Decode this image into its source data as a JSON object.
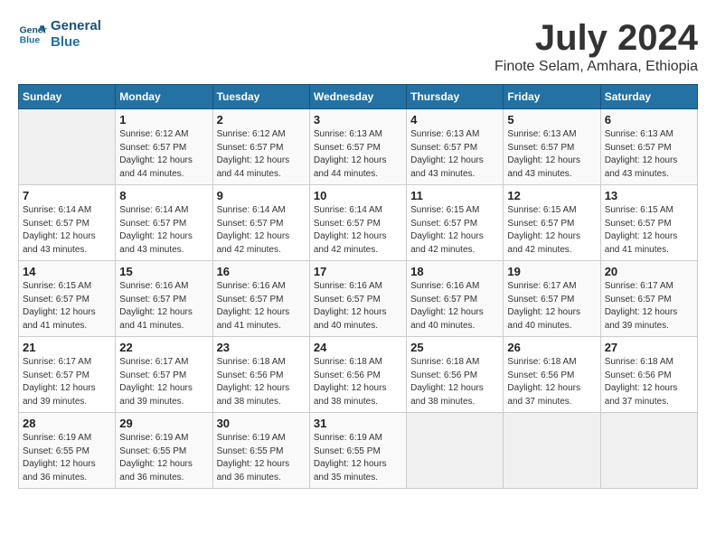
{
  "logo": {
    "line1": "General",
    "line2": "Blue"
  },
  "title": "July 2024",
  "subtitle": "Finote Selam, Amhara, Ethiopia",
  "days_of_week": [
    "Sunday",
    "Monday",
    "Tuesday",
    "Wednesday",
    "Thursday",
    "Friday",
    "Saturday"
  ],
  "weeks": [
    [
      {
        "day": "",
        "info": ""
      },
      {
        "day": "1",
        "info": "Sunrise: 6:12 AM\nSunset: 6:57 PM\nDaylight: 12 hours\nand 44 minutes."
      },
      {
        "day": "2",
        "info": "Sunrise: 6:12 AM\nSunset: 6:57 PM\nDaylight: 12 hours\nand 44 minutes."
      },
      {
        "day": "3",
        "info": "Sunrise: 6:13 AM\nSunset: 6:57 PM\nDaylight: 12 hours\nand 44 minutes."
      },
      {
        "day": "4",
        "info": "Sunrise: 6:13 AM\nSunset: 6:57 PM\nDaylight: 12 hours\nand 43 minutes."
      },
      {
        "day": "5",
        "info": "Sunrise: 6:13 AM\nSunset: 6:57 PM\nDaylight: 12 hours\nand 43 minutes."
      },
      {
        "day": "6",
        "info": "Sunrise: 6:13 AM\nSunset: 6:57 PM\nDaylight: 12 hours\nand 43 minutes."
      }
    ],
    [
      {
        "day": "7",
        "info": "Sunrise: 6:14 AM\nSunset: 6:57 PM\nDaylight: 12 hours\nand 43 minutes."
      },
      {
        "day": "8",
        "info": "Sunrise: 6:14 AM\nSunset: 6:57 PM\nDaylight: 12 hours\nand 43 minutes."
      },
      {
        "day": "9",
        "info": "Sunrise: 6:14 AM\nSunset: 6:57 PM\nDaylight: 12 hours\nand 42 minutes."
      },
      {
        "day": "10",
        "info": "Sunrise: 6:14 AM\nSunset: 6:57 PM\nDaylight: 12 hours\nand 42 minutes."
      },
      {
        "day": "11",
        "info": "Sunrise: 6:15 AM\nSunset: 6:57 PM\nDaylight: 12 hours\nand 42 minutes."
      },
      {
        "day": "12",
        "info": "Sunrise: 6:15 AM\nSunset: 6:57 PM\nDaylight: 12 hours\nand 42 minutes."
      },
      {
        "day": "13",
        "info": "Sunrise: 6:15 AM\nSunset: 6:57 PM\nDaylight: 12 hours\nand 41 minutes."
      }
    ],
    [
      {
        "day": "14",
        "info": "Sunrise: 6:15 AM\nSunset: 6:57 PM\nDaylight: 12 hours\nand 41 minutes."
      },
      {
        "day": "15",
        "info": "Sunrise: 6:16 AM\nSunset: 6:57 PM\nDaylight: 12 hours\nand 41 minutes."
      },
      {
        "day": "16",
        "info": "Sunrise: 6:16 AM\nSunset: 6:57 PM\nDaylight: 12 hours\nand 41 minutes."
      },
      {
        "day": "17",
        "info": "Sunrise: 6:16 AM\nSunset: 6:57 PM\nDaylight: 12 hours\nand 40 minutes."
      },
      {
        "day": "18",
        "info": "Sunrise: 6:16 AM\nSunset: 6:57 PM\nDaylight: 12 hours\nand 40 minutes."
      },
      {
        "day": "19",
        "info": "Sunrise: 6:17 AM\nSunset: 6:57 PM\nDaylight: 12 hours\nand 40 minutes."
      },
      {
        "day": "20",
        "info": "Sunrise: 6:17 AM\nSunset: 6:57 PM\nDaylight: 12 hours\nand 39 minutes."
      }
    ],
    [
      {
        "day": "21",
        "info": "Sunrise: 6:17 AM\nSunset: 6:57 PM\nDaylight: 12 hours\nand 39 minutes."
      },
      {
        "day": "22",
        "info": "Sunrise: 6:17 AM\nSunset: 6:57 PM\nDaylight: 12 hours\nand 39 minutes."
      },
      {
        "day": "23",
        "info": "Sunrise: 6:18 AM\nSunset: 6:56 PM\nDaylight: 12 hours\nand 38 minutes."
      },
      {
        "day": "24",
        "info": "Sunrise: 6:18 AM\nSunset: 6:56 PM\nDaylight: 12 hours\nand 38 minutes."
      },
      {
        "day": "25",
        "info": "Sunrise: 6:18 AM\nSunset: 6:56 PM\nDaylight: 12 hours\nand 38 minutes."
      },
      {
        "day": "26",
        "info": "Sunrise: 6:18 AM\nSunset: 6:56 PM\nDaylight: 12 hours\nand 37 minutes."
      },
      {
        "day": "27",
        "info": "Sunrise: 6:18 AM\nSunset: 6:56 PM\nDaylight: 12 hours\nand 37 minutes."
      }
    ],
    [
      {
        "day": "28",
        "info": "Sunrise: 6:19 AM\nSunset: 6:55 PM\nDaylight: 12 hours\nand 36 minutes."
      },
      {
        "day": "29",
        "info": "Sunrise: 6:19 AM\nSunset: 6:55 PM\nDaylight: 12 hours\nand 36 minutes."
      },
      {
        "day": "30",
        "info": "Sunrise: 6:19 AM\nSunset: 6:55 PM\nDaylight: 12 hours\nand 36 minutes."
      },
      {
        "day": "31",
        "info": "Sunrise: 6:19 AM\nSunset: 6:55 PM\nDaylight: 12 hours\nand 35 minutes."
      },
      {
        "day": "",
        "info": ""
      },
      {
        "day": "",
        "info": ""
      },
      {
        "day": "",
        "info": ""
      }
    ]
  ]
}
